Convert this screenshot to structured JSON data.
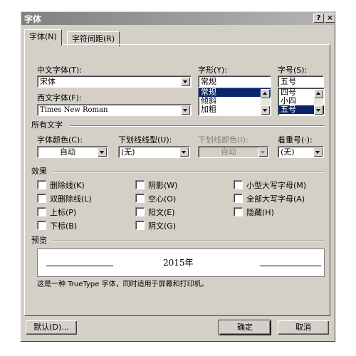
{
  "dialog": {
    "title": "字体"
  },
  "titlebar": {
    "help": "?",
    "close": "×"
  },
  "tabs": [
    "字体(N)",
    "字符间距(R)"
  ],
  "chinese_font": {
    "label": "中文字体(T):",
    "value": "宋体"
  },
  "western_font": {
    "label": "西文字体(F):",
    "value": "Times New Roman"
  },
  "font_style": {
    "label": "字形(Y):",
    "value": "常规",
    "options": [
      "常规",
      "倾斜",
      "加粗"
    ],
    "selected": "常规"
  },
  "font_size": {
    "label": "字号(S):",
    "value": "五号",
    "options": [
      "四号",
      "小四",
      "五号"
    ],
    "selected": "五号"
  },
  "all_text": {
    "section": "所有文字",
    "font_color_label": "字体颜色(C):",
    "font_color_value": "自动",
    "underline_style_label": "下划线线型(U):",
    "underline_style_value": "(无)",
    "underline_color_label": "下划线颜色(I):",
    "underline_color_value": "自动",
    "emphasis_label": "着重号(·):",
    "emphasis_value": "(无)"
  },
  "effects": {
    "section": "效果",
    "items": [
      "删除线(K)",
      "双删除线(L)",
      "上标(P)",
      "下标(B)",
      "阴影(W)",
      "空心(O)",
      "阳文(E)",
      "阴文(G)",
      "小型大写字母(M)",
      "全部大写字母(A)",
      "隐藏(H)"
    ]
  },
  "preview": {
    "section": "预览",
    "sample": "2015年",
    "note": "这是一种 TrueType 字体，同时适用于屏幕和打印机。"
  },
  "buttons": {
    "default": "默认(D)...",
    "ok": "确定",
    "cancel": "取消"
  }
}
